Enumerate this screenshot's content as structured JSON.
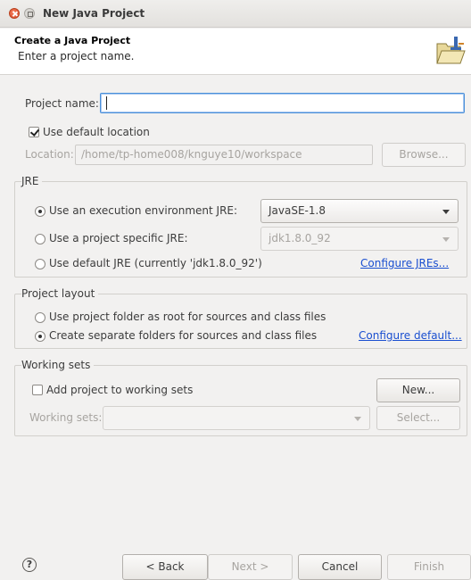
{
  "window": {
    "title": "New Java Project"
  },
  "header": {
    "title": "Create a Java Project",
    "description": "Enter a project name."
  },
  "project_name": {
    "label": "Project name:",
    "value": ""
  },
  "location": {
    "use_default_label": "Use default location",
    "use_default_checked": true,
    "label": "Location:",
    "value": "/home/tp-home008/knguye10/workspace",
    "browse_label": "Browse..."
  },
  "jre": {
    "group_label": "JRE",
    "option_env_label": "Use an execution environment JRE:",
    "option_env_value": "JavaSE-1.8",
    "option_specific_label": "Use a project specific JRE:",
    "option_specific_value": "jdk1.8.0_92",
    "option_default_label": "Use default JRE (currently 'jdk1.8.0_92')",
    "configure_link": "Configure JREs...",
    "selected": "env"
  },
  "project_layout": {
    "group_label": "Project layout",
    "option_root_label": "Use project folder as root for sources and class files",
    "option_separate_label": "Create separate folders for sources and class files",
    "configure_link": "Configure default...",
    "selected": "separate"
  },
  "working_sets": {
    "group_label": "Working sets",
    "add_label": "Add project to working sets",
    "add_checked": false,
    "new_label": "New...",
    "sets_label": "Working sets:",
    "sets_value": "",
    "select_label": "Select..."
  },
  "footer": {
    "help_icon": "?",
    "back_label": "< Back",
    "next_label": "Next >",
    "cancel_label": "Cancel",
    "finish_label": "Finish"
  }
}
